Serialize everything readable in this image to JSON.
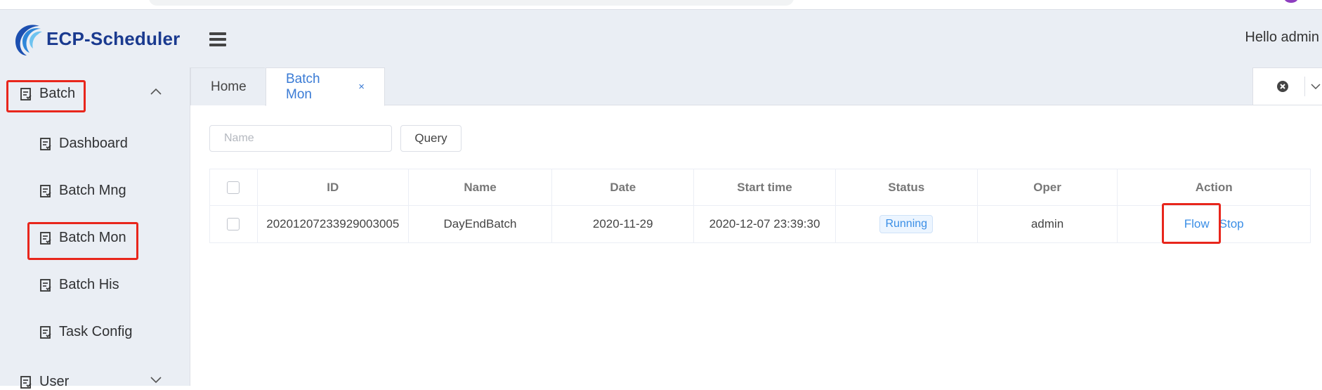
{
  "app": {
    "logo_text": "ECP-Scheduler",
    "greeting": "Hello admin"
  },
  "sidebar": {
    "groups": [
      {
        "label": "Batch",
        "icon": "document-icon",
        "expanded": true
      },
      {
        "label": "User",
        "icon": "document-icon",
        "expanded": false
      }
    ],
    "items": [
      {
        "label": "Dashboard",
        "icon": "document-icon"
      },
      {
        "label": "Batch Mng",
        "icon": "document-icon"
      },
      {
        "label": "Batch Mon",
        "icon": "document-icon",
        "active": true
      },
      {
        "label": "Batch His",
        "icon": "document-icon"
      },
      {
        "label": "Task Config",
        "icon": "document-icon"
      }
    ]
  },
  "tabs": [
    {
      "label": "Home"
    },
    {
      "label": "Batch Mon",
      "active": true,
      "close": "×"
    }
  ],
  "search": {
    "placeholder": "Name",
    "value": "",
    "query_label": "Query"
  },
  "table": {
    "columns": [
      "ID",
      "Name",
      "Date",
      "Start time",
      "Status",
      "Oper",
      "Action"
    ],
    "rows": [
      {
        "id": "20201207233929003005",
        "name": "DayEndBatch",
        "date": "2020-11-29",
        "start_time": "2020-12-07 23:39:30",
        "status": "Running",
        "oper": "admin",
        "actions": [
          "Flow",
          "Stop"
        ]
      }
    ]
  },
  "colors": {
    "accent": "#3a8ee6",
    "highlight": "#e8261c",
    "logo": "#1a3a8f",
    "panel": "#eaeef4"
  }
}
